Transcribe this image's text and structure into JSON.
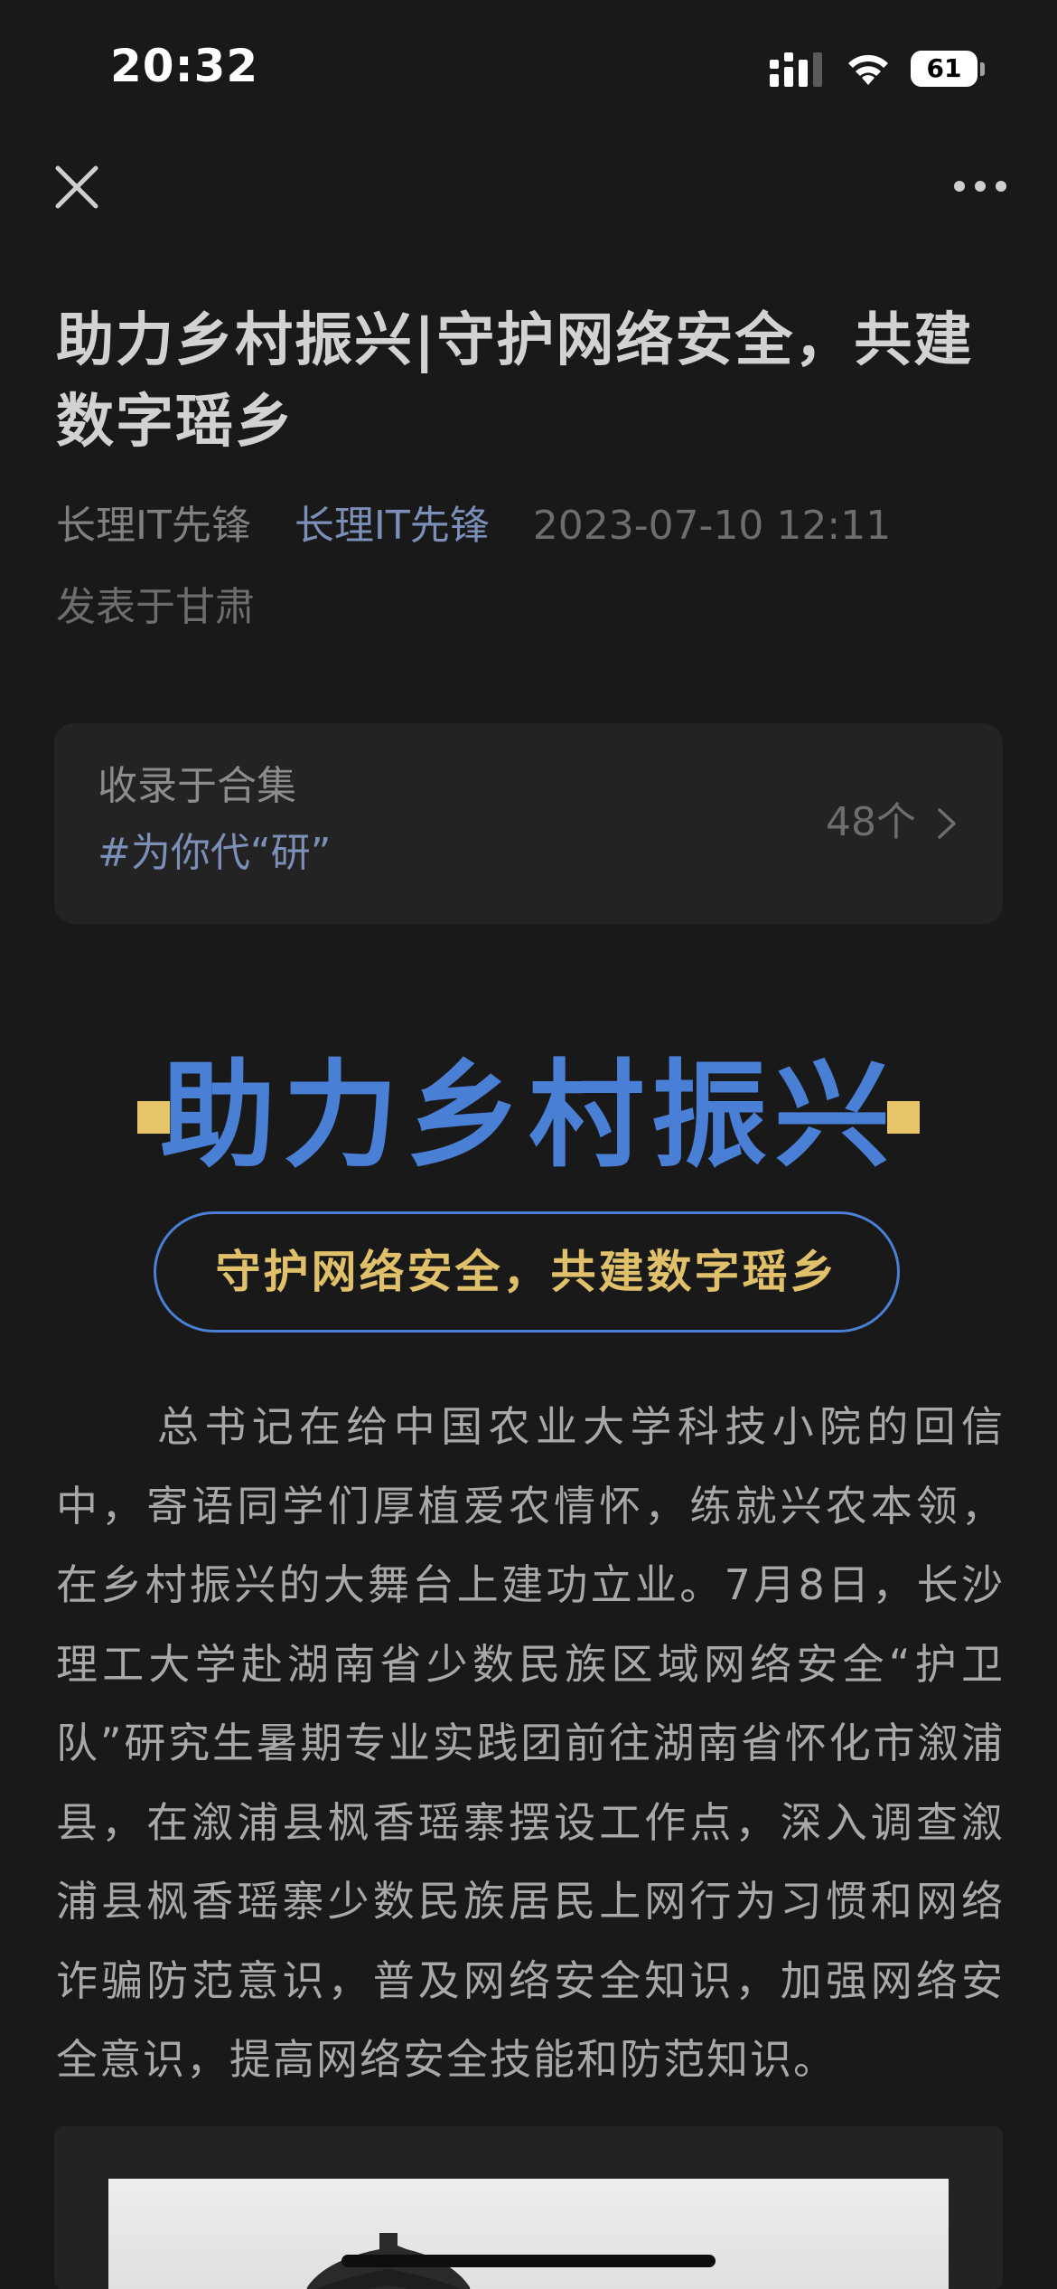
{
  "status_bar": {
    "time": "20:32",
    "battery": "61"
  },
  "nav": {
    "close_icon": "close-icon",
    "more_icon": "more-icon"
  },
  "article": {
    "title": "助力乡村振兴|守护网络安全，共建数字瑶乡",
    "author": "长理IT先锋",
    "account": "长理IT先锋",
    "date": "2023-07-10 12:11",
    "location": "发表于甘肃"
  },
  "collection": {
    "label": "收录于合集",
    "tag": "#为你代“研”",
    "count": "48个"
  },
  "banner": {
    "heading": "助力乡村振兴",
    "subheading": "守护网络安全，共建数字瑶乡",
    "accent_color": "#4a7fd6",
    "gold_color": "#e0c06a"
  },
  "body": {
    "paragraph": "总书记在给中国农业大学科技小院的回信中，寄语同学们厚植爱农情怀，练就兴农本领，在乡村振兴的大舞台上建功立业。7月8日，长沙理工大学赴湖南省少数民族区域网络安全“护卫队”研究生暑期专业实践团前往湖南省怀化市溆浦县，在溆浦县枫香瑶寨摆设工作点，深入调查溆浦县枫香瑶寨少数民族居民上网行为习惯和网络诈骗防范意识，普及网络安全知识，加强网络安全意识，提高网络安全技能和防范知识。"
  }
}
